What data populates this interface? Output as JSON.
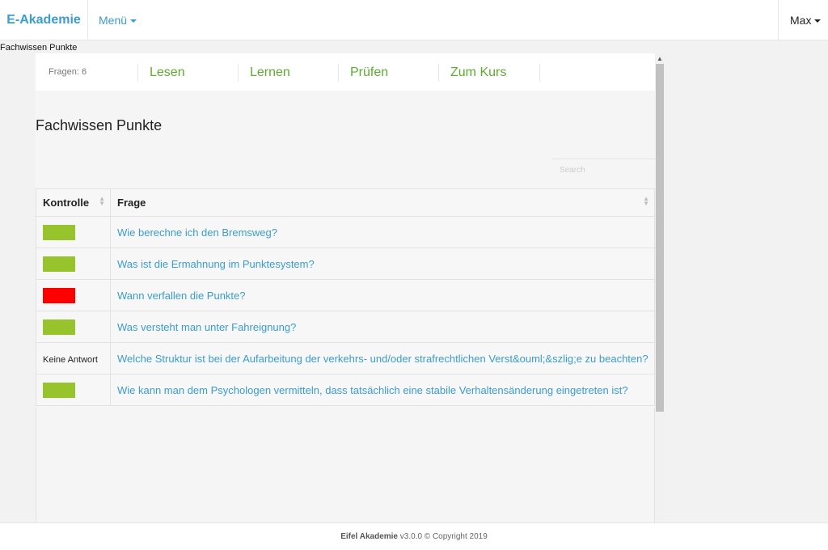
{
  "navbar": {
    "brand": "E-Akademie",
    "menu_label": "Menü",
    "user_label": "Max"
  },
  "breadcrumb": "Fachwissen Punkte",
  "tabs": {
    "count_label": "Fragen: 6",
    "items": [
      "Lesen",
      "Lernen",
      "Prüfen",
      "Zum Kurs"
    ]
  },
  "page_title": "Fachwissen Punkte",
  "search": {
    "placeholder": "Search",
    "value": ""
  },
  "table": {
    "headers": [
      "Kontrolle",
      "Frage"
    ],
    "rows": [
      {
        "status": "correct",
        "status_color": "#97c42d",
        "frage": "Wie berechne ich den Bremsweg?"
      },
      {
        "status": "correct",
        "status_color": "#97c42d",
        "frage": "Was ist die Ermahnung im Punktesystem?"
      },
      {
        "status": "wrong",
        "status_color": "#ff0000",
        "frage": "Wann verfallen die Punkte?"
      },
      {
        "status": "correct",
        "status_color": "#97c42d",
        "frage": "Was versteht man unter Fahreignung?"
      },
      {
        "status": "none",
        "status_text": "Keine Antwort",
        "frage": "Welche Struktur ist bei der Aufarbeitung der verkehrs- und/oder strafrechtlichen Verst&ouml;&szlig;e zu beachten?"
      },
      {
        "status": "correct",
        "status_color": "#97c42d",
        "frage": "Wie kann man dem Psychologen vermitteln, dass tatsächlich eine stabile Verhaltensänderung eingetreten ist?"
      }
    ]
  },
  "footer": {
    "app_name": "Eifel Akademie",
    "version_text": "v3.0.0 © Copyright 2019"
  },
  "colors": {
    "accent": "#3b9cd0",
    "tab_green": "#5cad2f",
    "status_green": "#97c42d",
    "status_red": "#ff0000"
  }
}
